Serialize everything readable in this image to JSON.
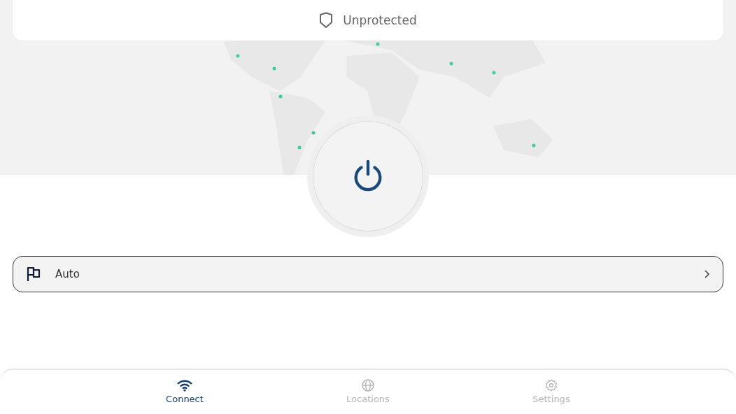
{
  "status": {
    "text": "Unprotected"
  },
  "location": {
    "label": "Auto"
  },
  "tabs": [
    {
      "label": "Connect",
      "kind": "wifi",
      "selected": true
    },
    {
      "label": "Locations",
      "kind": "globe",
      "selected": false
    },
    {
      "label": "Settings",
      "kind": "gear",
      "selected": false
    }
  ]
}
